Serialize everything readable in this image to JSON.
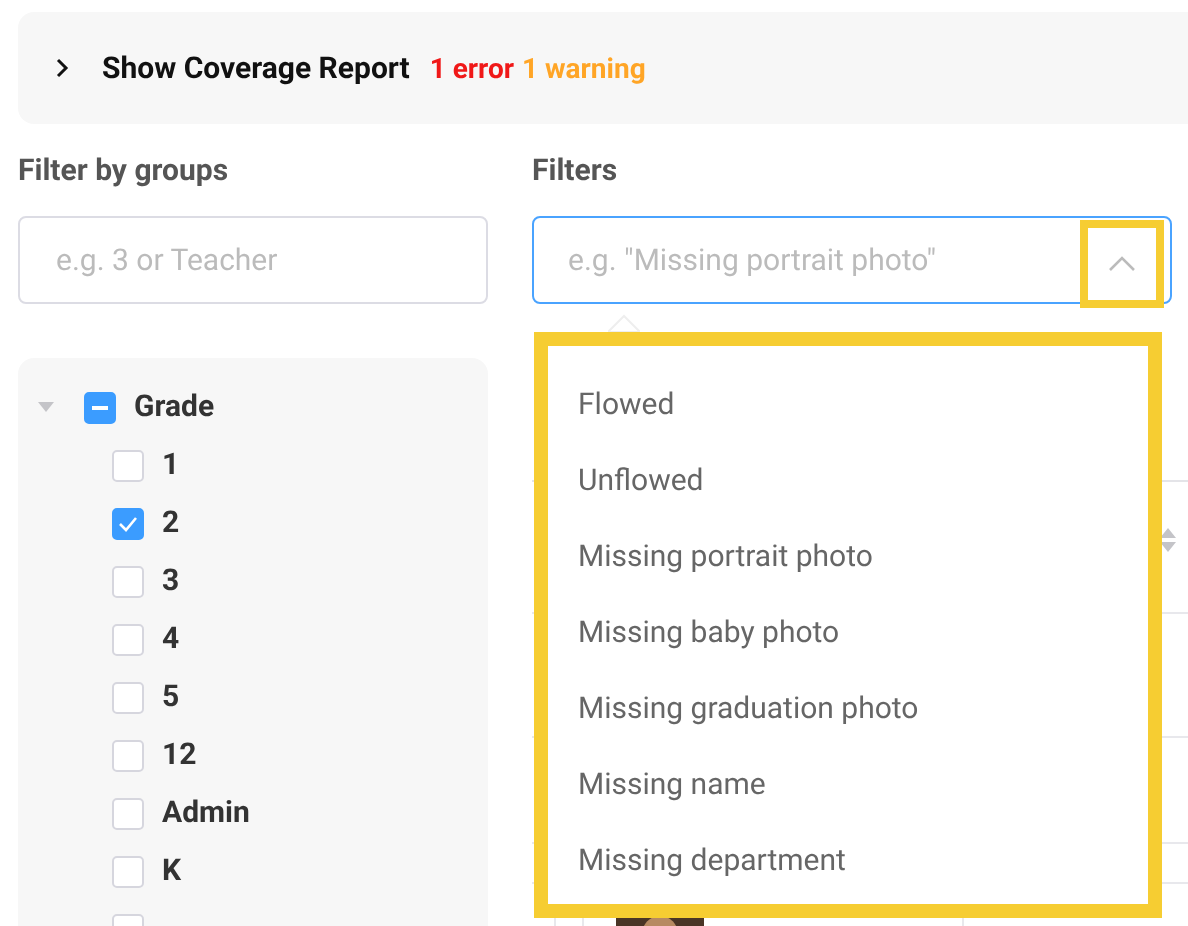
{
  "coverage": {
    "expanded": false,
    "title": "Show Coverage Report",
    "errors": "1 error",
    "warnings": "1 warning"
  },
  "group_filter": {
    "label": "Filter by groups",
    "placeholder": "e.g. 3 or Teacher"
  },
  "filters": {
    "label": "Filters",
    "placeholder": "e.g. \"Missing portrait photo\"",
    "open": true,
    "options": [
      {
        "label": "Flowed"
      },
      {
        "label": "Unflowed"
      },
      {
        "label": "Missing portrait photo"
      },
      {
        "label": "Missing baby photo"
      },
      {
        "label": "Missing graduation photo"
      },
      {
        "label": "Missing name"
      },
      {
        "label": "Missing department"
      }
    ]
  },
  "tree": [
    {
      "label": "Grade",
      "expanded": true,
      "checked": false,
      "partial": true,
      "children": [
        {
          "label": "1",
          "checked": false
        },
        {
          "label": "2",
          "checked": true
        },
        {
          "label": "3",
          "checked": false
        },
        {
          "label": "4",
          "checked": false
        },
        {
          "label": "5",
          "checked": false
        },
        {
          "label": "12",
          "checked": false
        },
        {
          "label": "Admin",
          "checked": false
        },
        {
          "label": "K",
          "checked": false
        },
        {
          "checked": false
        }
      ]
    }
  ]
}
